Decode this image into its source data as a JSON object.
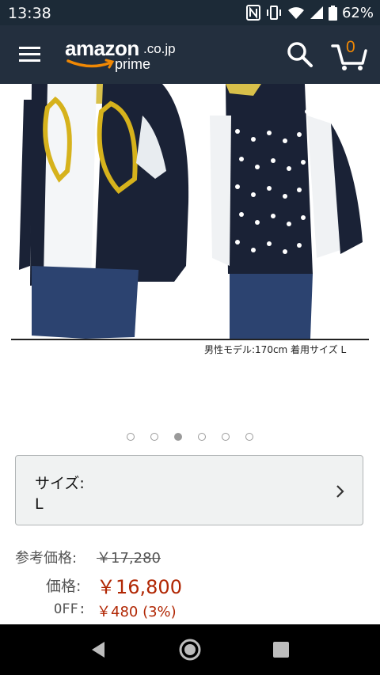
{
  "status_bar": {
    "time": "13:38",
    "battery": "62%",
    "icons": [
      "nfc-icon",
      "vibrate-icon",
      "wifi-icon",
      "signal-icon",
      "battery-icon"
    ]
  },
  "header": {
    "logo_main": "amazon",
    "logo_suffix": ".co.jp",
    "logo_sub": "prime",
    "cart_count": "0",
    "colors": {
      "background": "#232f3e",
      "accent": "#f08804"
    }
  },
  "product": {
    "image_caption": "男性モデル:170cm 着用サイズ L",
    "image_count": 6,
    "active_image_index": 2
  },
  "size_selector": {
    "label": "サイズ:",
    "value": "L"
  },
  "pricing": {
    "reference_label": "参考価格:",
    "reference_value": "￥17,280",
    "price_label": "価格:",
    "price_value": "￥16,800",
    "off_label": "OFF:",
    "off_value": "￥480 (3%)",
    "colors": {
      "price": "#b12704"
    }
  },
  "nav_bar": {
    "icons": [
      "back-icon",
      "home-icon",
      "recents-icon"
    ]
  }
}
